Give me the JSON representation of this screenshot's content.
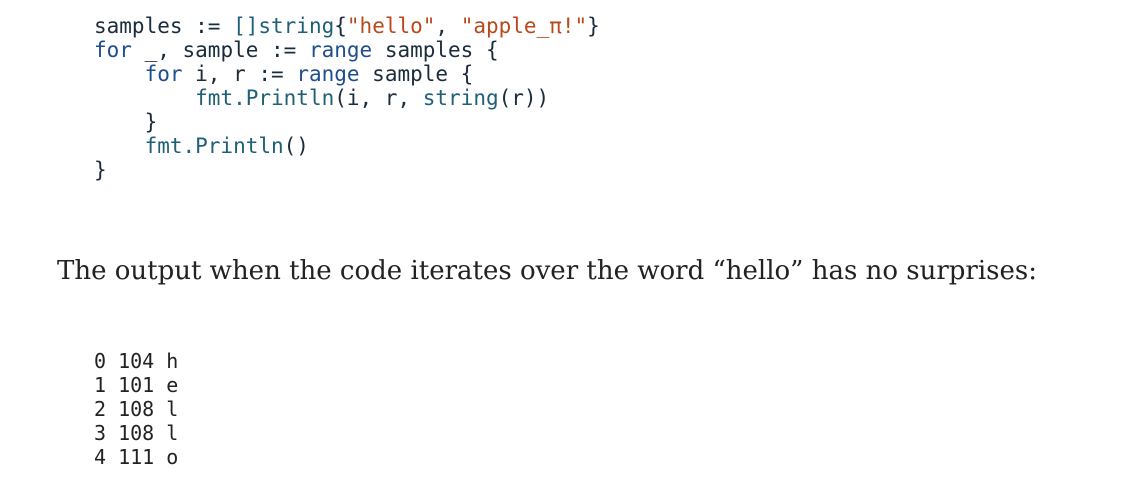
{
  "code_block": {
    "line1": {
      "var": "samples",
      "op": " := ",
      "type": "[]string",
      "open": "{",
      "s1": "\"hello\"",
      "comma": ", ",
      "s2": "\"apple_π!\"",
      "close": "}"
    },
    "line2": {
      "kw": "for",
      "mid": " _, sample := ",
      "kw2": "range",
      "rest": " samples {"
    },
    "line3": {
      "indent": "    ",
      "kw": "for",
      "mid": " i, r := ",
      "kw2": "range",
      "rest": " sample {"
    },
    "line4": {
      "indent": "        ",
      "call": "fmt.Println",
      "args_a": "(i, r, ",
      "conv": "string",
      "args_b": "(r))"
    },
    "line5": {
      "text": "    }"
    },
    "line6": {
      "indent": "    ",
      "call": "fmt.Println",
      "args": "()"
    },
    "line7": {
      "text": "}"
    }
  },
  "paragraph": {
    "text": "The output when the code iterates over the word “hello” has no surprises:"
  },
  "output_block": {
    "rows": [
      "0 104 h",
      "1 101 e",
      "2 108 l",
      "3 108 l",
      "4 111 o"
    ]
  }
}
